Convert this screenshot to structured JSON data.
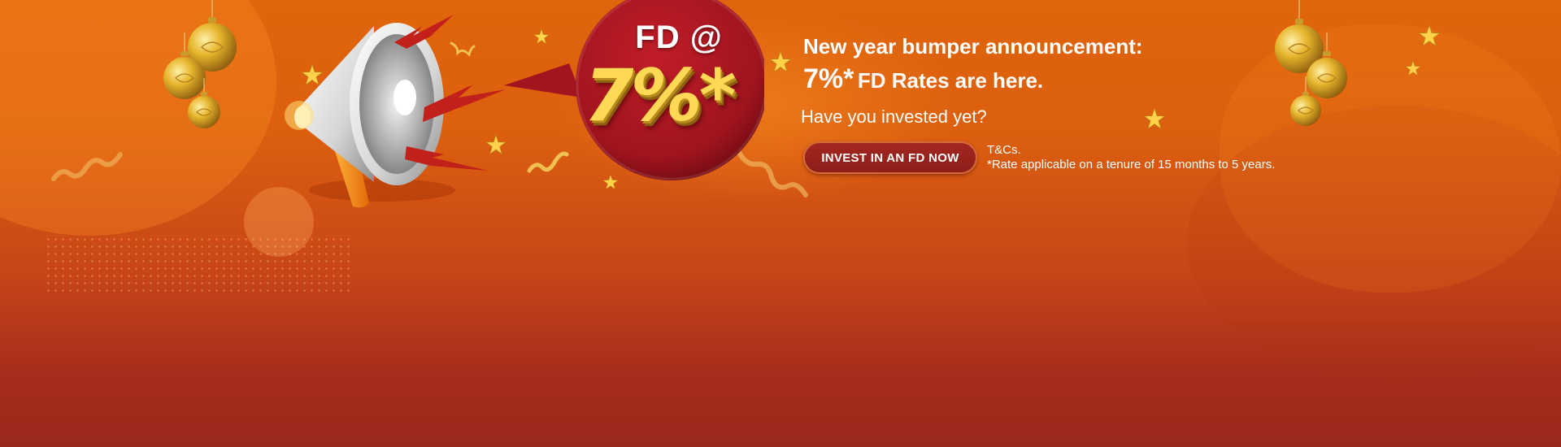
{
  "promo": {
    "badge": {
      "title": "FD @",
      "rate": "7%*"
    },
    "headline": "New year bumper announcement:",
    "rate_line": {
      "rate": "7%*",
      "text": "FD Rates are here."
    },
    "question": "Have you invested yet?",
    "cta_label": "INVEST IN AN FD NOW",
    "tnc_title": "T&Cs.",
    "tnc_text": "*Rate applicable on a tenure of 15 months to 5 years."
  },
  "icons": [
    "megaphone-icon",
    "speech-bubble-icon",
    "gold-ornament-icon",
    "star-icon",
    "confetti-icon"
  ],
  "colors": {
    "background_top": "#e0650c",
    "background_bottom": "#9a281c",
    "bubble": "#a8141f",
    "rate_gold": "#ffd955",
    "cta_button": "#a32720",
    "text": "#ffffff"
  }
}
